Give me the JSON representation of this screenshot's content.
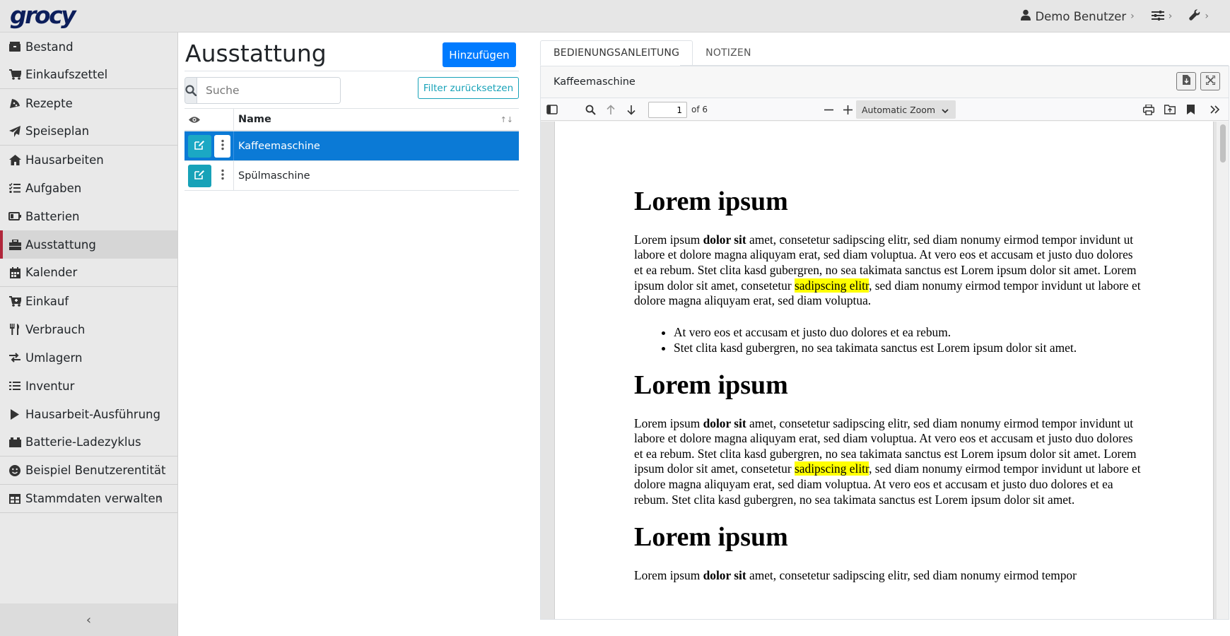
{
  "app": {
    "logo": "grocy"
  },
  "topbar": {
    "user_label": "Demo Benutzer"
  },
  "sidebar": {
    "items": [
      {
        "label": "Bestand",
        "icon": "box-icon"
      },
      {
        "label": "Einkaufszettel",
        "icon": "cart-icon"
      },
      {
        "label": "Rezepte",
        "icon": "pizza-icon"
      },
      {
        "label": "Speiseplan",
        "icon": "paper-plane-icon"
      },
      {
        "label": "Hausarbeiten",
        "icon": "home-icon"
      },
      {
        "label": "Aufgaben",
        "icon": "tasks-icon"
      },
      {
        "label": "Batterien",
        "icon": "battery-icon"
      },
      {
        "label": "Ausstattung",
        "icon": "toolbox-icon"
      },
      {
        "label": "Kalender",
        "icon": "calendar-icon"
      },
      {
        "label": "Einkauf",
        "icon": "cart-plus-icon"
      },
      {
        "label": "Verbrauch",
        "icon": "utensils-icon"
      },
      {
        "label": "Umlagern",
        "icon": "exchange-icon"
      },
      {
        "label": "Inventur",
        "icon": "list-icon"
      },
      {
        "label": "Hausarbeit-Ausführung",
        "icon": "play-icon"
      },
      {
        "label": "Batterie-Ladezyklus",
        "icon": "car-battery-icon"
      },
      {
        "label": "Beispiel Benutzerentität",
        "icon": "smile-icon"
      },
      {
        "label": "Stammdaten verwalten",
        "icon": "table-icon"
      }
    ]
  },
  "main": {
    "title": "Ausstattung",
    "add_button": "Hinzufügen",
    "search_placeholder": "Suche",
    "filter_reset_button": "Filter zurücksetzen",
    "table": {
      "header_name": "Name",
      "rows": [
        {
          "name": "Kaffeemaschine",
          "selected": true
        },
        {
          "name": "Spülmaschine",
          "selected": false
        }
      ]
    }
  },
  "detail": {
    "tabs": [
      {
        "label": "BEDIENUNGSANLEITUNG",
        "active": true
      },
      {
        "label": "NOTIZEN",
        "active": false
      }
    ],
    "card_title": "Kaffeemaschine",
    "pdf": {
      "page_number": "1",
      "page_of": "of 6",
      "zoom": "Automatic Zoom",
      "sections": [
        {
          "heading": "Lorem ipsum",
          "para_a": "Lorem ipsum ",
          "para_bold": "dolor sit",
          "para_b": " amet, consetetur sadipscing elitr, sed diam nonumy eirmod tempor invidunt ut labore et dolore magna aliquyam erat, sed diam voluptua. At vero eos et accusam et justo duo dolores et ea rebum. Stet clita kasd gubergren, no sea takimata sanctus est Lorem ipsum dolor sit amet. Lorem ipsum dolor sit amet, consetetur ",
          "para_highlight": "sadipscing elitr",
          "para_c": ", sed diam nonumy eirmod tempor invidunt ut labore et dolore magna aliquyam erat, sed diam voluptua.",
          "bullets": [
            "At vero eos et accusam et justo duo dolores et ea rebum.",
            "Stet clita kasd gubergren, no sea takimata sanctus est Lorem ipsum dolor sit amet."
          ]
        },
        {
          "heading": "Lorem ipsum",
          "para_a": "Lorem ipsum ",
          "para_bold": "dolor sit",
          "para_b": " amet, consetetur sadipscing elitr, sed diam nonumy eirmod tempor invidunt ut labore et dolore magna aliquyam erat, sed diam voluptua. At vero eos et accusam et justo duo dolores et ea rebum. Stet clita kasd gubergren, no sea takimata sanctus est Lorem ipsum dolor sit amet. Lorem ipsum dolor sit amet, consetetur ",
          "para_highlight": "sadipscing elitr",
          "para_c": ", sed diam nonumy eirmod tempor invidunt ut labore et dolore magna aliquyam erat, sed diam voluptua. At vero eos et accusam et justo duo dolores et ea rebum. Stet clita kasd gubergren, no sea takimata sanctus est Lorem ipsum dolor sit amet."
        },
        {
          "heading": "Lorem ipsum",
          "para_a": "Lorem ipsum ",
          "para_bold": "dolor sit",
          "para_b": " amet, consetetur sadipscing elitr, sed diam nonumy eirmod tempor"
        }
      ]
    }
  },
  "colors": {
    "primary": "#007bff",
    "info": "#17a2b8",
    "selected_row": "#0b7ad6",
    "active_marker": "#b0263a",
    "highlight": "#ffff00"
  }
}
